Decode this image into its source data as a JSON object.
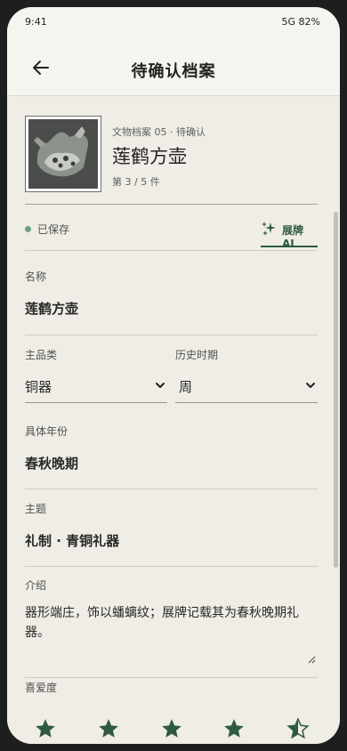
{
  "status": {
    "time": "9:41",
    "right": "5G  82%"
  },
  "app_bar": {
    "title": "待确认档案"
  },
  "record": {
    "meta": "文物档案 05 · 待确认",
    "title": "莲鹤方壶",
    "subtitle": "第 3 / 5 件"
  },
  "save": {
    "status": "已保存",
    "ai_label": "展牌 AI"
  },
  "form": {
    "name_label": "名称",
    "name_value": "莲鹤方壶",
    "category_label": "主品类",
    "category_value": "铜器",
    "period_label": "历史时期",
    "period_value": "周",
    "year_label": "具体年份",
    "year_value": "春秋晚期",
    "theme_label": "主题",
    "theme_value": "礼制 · 青铜礼器",
    "intro_label": "介绍",
    "intro_value": "器形端庄，饰以蟠螭纹；展牌记载其为春秋晚期礼器。",
    "rating_label": "喜爱度",
    "rating_value": 4.5,
    "rating_max": 5
  },
  "colors": {
    "accent": "#2e5a44",
    "saved": "#6ea07f",
    "background": "#f0ede6"
  },
  "icons": {
    "back": "arrow-left-icon",
    "ai": "sparkle-icon",
    "dropdown": "chevron-down-icon",
    "star": "star-icon"
  }
}
